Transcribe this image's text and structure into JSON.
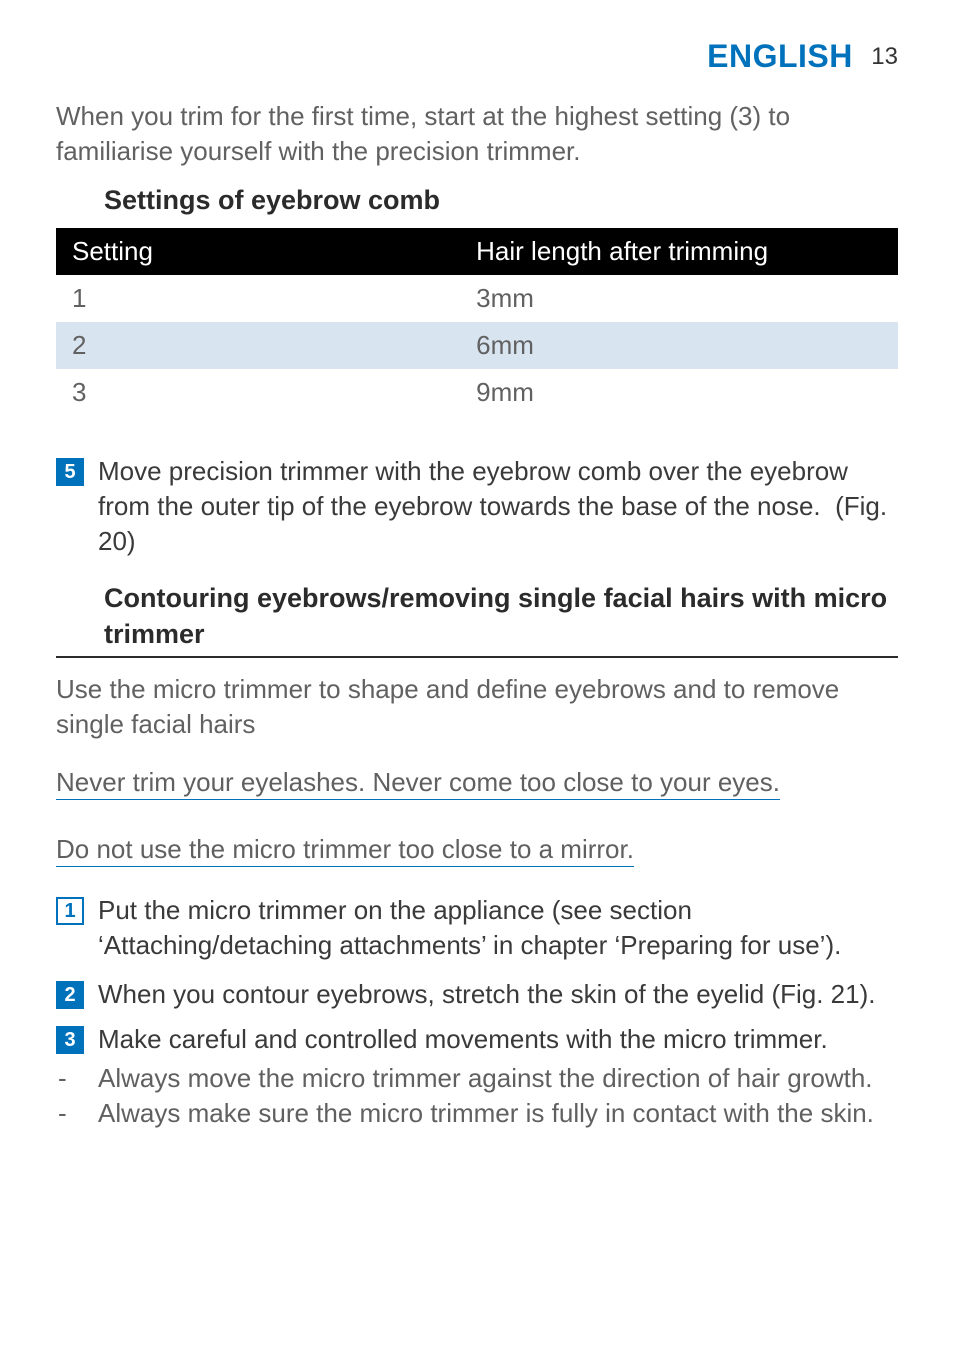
{
  "header": {
    "language": "ENGLISH",
    "page_number": "13"
  },
  "intro": "When you trim for the first time, start at the highest setting (3) to familiarise yourself with the precision trimmer.",
  "table": {
    "title": "Settings of eyebrow comb",
    "columns": [
      "Setting",
      "Hair length after trimming"
    ],
    "rows": [
      {
        "setting": "1",
        "length": "3mm"
      },
      {
        "setting": "2",
        "length": "6mm"
      },
      {
        "setting": "3",
        "length": "9mm"
      }
    ]
  },
  "chart_data": {
    "type": "table",
    "title": "Settings of eyebrow comb",
    "columns": [
      "Setting",
      "Hair length after trimming"
    ],
    "rows": [
      [
        "1",
        "3mm"
      ],
      [
        "2",
        "6mm"
      ],
      [
        "3",
        "9mm"
      ]
    ]
  },
  "step5": {
    "num": "5",
    "text": "Move precision trimmer with the eyebrow comb over the eyebrow from the outer tip of the eyebrow towards the base of the nose.  (Fig. 20)"
  },
  "section2": {
    "heading": "Contouring eyebrows/removing single facial hairs with micro trimmer",
    "intro": "Use the micro trimmer to shape and define eyebrows and to remove single facial hairs",
    "warn1": "Never trim your eyelashes. Never come too close to your eyes.",
    "warn2": "Do not use the micro trimmer too close to a mirror.",
    "steps": [
      {
        "num": "1",
        "text": "Put the micro trimmer on the appliance (see section ‘Attaching/detaching attachments’ in chapter ‘Preparing for use’)."
      },
      {
        "num": "2",
        "text": "When you contour eyebrows, stretch the skin of the eyelid (Fig. 21)."
      },
      {
        "num": "3",
        "text": "Make careful and controlled movements with the micro trimmer."
      }
    ],
    "bullets": [
      "Always move the micro trimmer against the direction of hair growth.",
      "Always make sure the micro trimmer is fully in contact with the skin."
    ]
  }
}
